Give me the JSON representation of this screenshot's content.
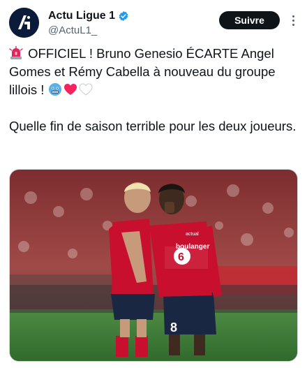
{
  "account": {
    "display_name": "Actu Ligue 1",
    "handle": "@ActuL1_",
    "verified": true,
    "avatar_icon": "actu-ligue1-logo"
  },
  "actions": {
    "follow_label": "Suivre",
    "more_icon": "more-options-icon"
  },
  "tweet": {
    "line1_emoji": "siren-emoji",
    "paragraph1": "OFFICIEL ! Bruno Genesio ÉCARTE Angel Gomes et Rémy Cabella à nouveau du groupe lillois !",
    "trailing_emojis": [
      "cold-face-emoji",
      "red-heart-emoji",
      "white-heart-emoji"
    ],
    "paragraph2": "Quelle fin de saison terrible pour les deux joueurs."
  },
  "media": {
    "shirt_number": "8",
    "sponsor": "boulanger",
    "sponsor_sub": "actual",
    "colors": {
      "shirt_red": "#c8102e",
      "shorts_navy": "#1a2742",
      "pitch": "#3f7a3a"
    }
  }
}
